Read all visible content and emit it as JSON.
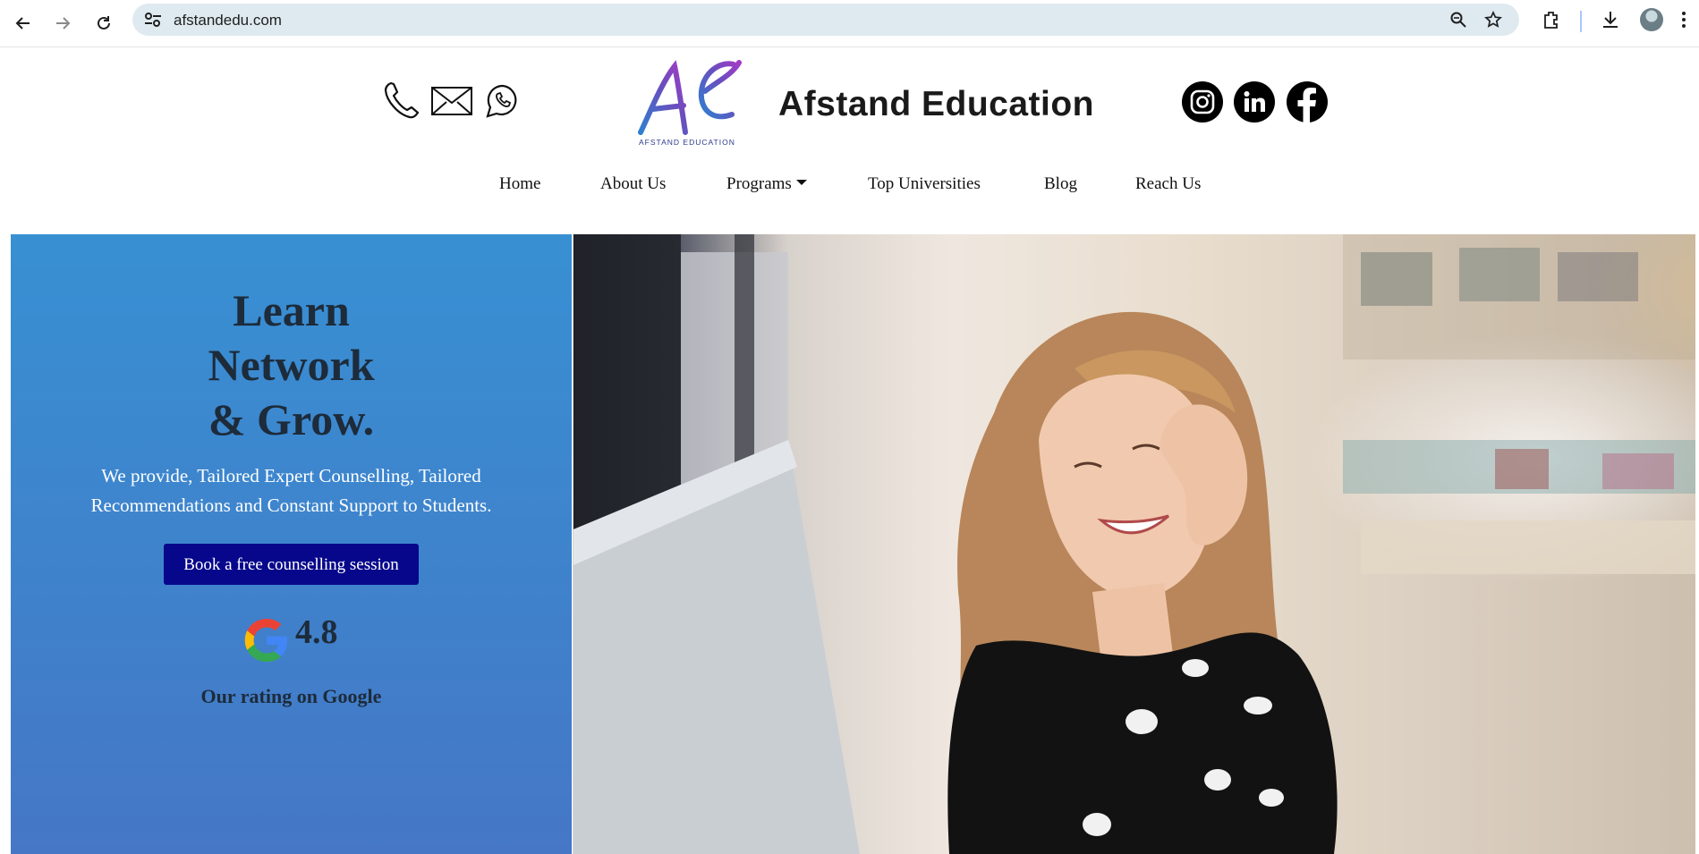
{
  "browser": {
    "url": "afstandedu.com",
    "icons": [
      "back-arrow-icon",
      "forward-arrow-icon",
      "reload-icon",
      "site-settings-icon",
      "zoom-icon",
      "bookmark-star-icon",
      "extensions-icon",
      "download-icon",
      "profile-avatar",
      "more-menu-icon"
    ]
  },
  "header": {
    "brand_name": "Afstand Education",
    "logo_text": "AFSTAND EDUCATION",
    "contact_icons": [
      "phone-icon",
      "email-icon",
      "whatsapp-icon"
    ],
    "social_icons": [
      "instagram-icon",
      "linkedin-icon",
      "facebook-icon"
    ]
  },
  "nav": {
    "items": [
      {
        "label": "Home"
      },
      {
        "label": "About Us"
      },
      {
        "label": "Programs"
      },
      {
        "label": "Top Universities"
      },
      {
        "label": "Blog"
      },
      {
        "label": "Reach Us"
      }
    ]
  },
  "hero": {
    "headline_line1": "Learn",
    "headline_line2": "Network",
    "headline_line3": "& Grow.",
    "subtitle": "We provide, Tailored Expert Counselling, Tailored Recommendations and Constant Support to Students.",
    "cta_label": "Book a free counselling session",
    "rating_value": "4.8",
    "rating_label": "Our rating on Google",
    "colors": {
      "gradient_top": "#3890d3",
      "gradient_bottom": "#4577c6",
      "cta_bg": "#07078c",
      "headline": "#1d2b3a"
    }
  }
}
